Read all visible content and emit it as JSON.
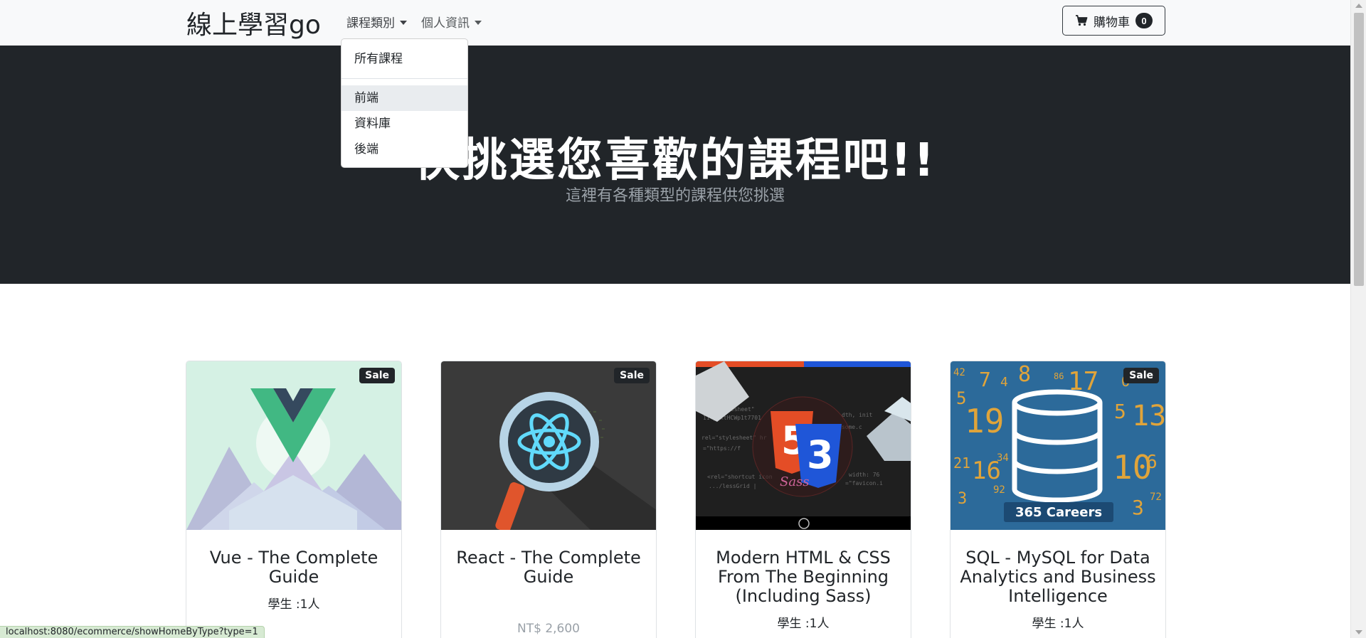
{
  "navbar": {
    "brand": "線上學習go",
    "nav_links": [
      {
        "label": "課程類別"
      },
      {
        "label": "個人資訊"
      }
    ],
    "cart": {
      "label": "購物車",
      "count": "0"
    }
  },
  "dropdown": {
    "items": [
      "所有課程",
      "前端",
      "資料庫",
      "後端"
    ]
  },
  "hero": {
    "title": "快挑選您喜歡的課程吧!!",
    "subtitle": "這裡有各種類型的課程供您挑選"
  },
  "cards": [
    {
      "title": "Vue - The Complete Guide",
      "badge": "Sale",
      "students": "學生 :1人",
      "price": ""
    },
    {
      "title": "React - The Complete Guide",
      "badge": "Sale",
      "students": "",
      "price": "NT$ 2,600"
    },
    {
      "title": "Modern HTML & CSS From The Beginning (Including Sass)",
      "badge": "",
      "students": "學生 :1人",
      "price": ""
    },
    {
      "title": "SQL - MySQL for Data Analytics and Business Intelligence",
      "badge": "Sale",
      "students": "學生 :1人",
      "price": ""
    }
  ],
  "card_image_text": {
    "careers": "365 Careers"
  },
  "statusbar": {
    "url": "localhost:8080/ecommerce/showHomeByType?type=1"
  },
  "colors": {
    "navbar_bg": "#f8f9fa",
    "hero_bg": "#212529",
    "vue_green": "#41b883",
    "vue_dark": "#35495e",
    "react_blue": "#61dafb",
    "html_orange": "#e44d26",
    "css_blue": "#1572b6",
    "sql_blue": "#2c6a9a"
  }
}
